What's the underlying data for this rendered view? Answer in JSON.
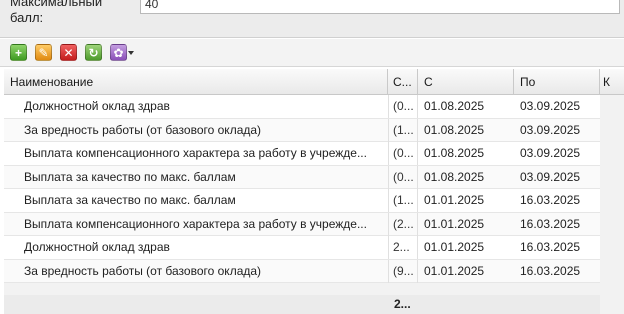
{
  "form": {
    "max_score_label": "Максимальный балл:",
    "max_score_value": "40"
  },
  "toolbar": {
    "add_icon": "add-icon",
    "edit_icon": "edit-icon",
    "delete_icon": "delete-icon",
    "refresh_icon": "refresh-icon",
    "settings_icon": "settings-icon",
    "add_glyph": "+",
    "edit_glyph": "✎",
    "delete_glyph": "✕",
    "refresh_glyph": "↻",
    "settings_glyph": "✿"
  },
  "grid": {
    "columns": [
      "Наименование",
      "С...",
      "С",
      "По",
      "К"
    ],
    "rows": [
      {
        "name": "Должностной оклад здрав",
        "code": "(0...",
        "from": "01.08.2025",
        "to": "03.09.2025"
      },
      {
        "name": "За вредность работы (от базового оклада)",
        "code": "(1...",
        "from": "01.08.2025",
        "to": "03.09.2025"
      },
      {
        "name": "Выплата компенсационного характера за работу в учрежде...",
        "code": "(0...",
        "from": "01.08.2025",
        "to": "03.09.2025"
      },
      {
        "name": "Выплата за качество по макс. баллам",
        "code": "(0...",
        "from": "01.08.2025",
        "to": "03.09.2025"
      },
      {
        "name": "Выплата за качество по макс. баллам",
        "code": "(1...",
        "from": "01.01.2025",
        "to": "16.03.2025"
      },
      {
        "name": "Выплата компенсационного характера за работу в учрежде...",
        "code": "(2...",
        "from": "01.01.2025",
        "to": "16.03.2025"
      },
      {
        "name": "Должностной оклад здрав",
        "code": "2...",
        "from": "01.01.2025",
        "to": "16.03.2025"
      },
      {
        "name": "За вредность работы (от базового оклада)",
        "code": "(9...",
        "from": "01.01.2025",
        "to": "16.03.2025"
      }
    ],
    "pager_text": "2..."
  }
}
